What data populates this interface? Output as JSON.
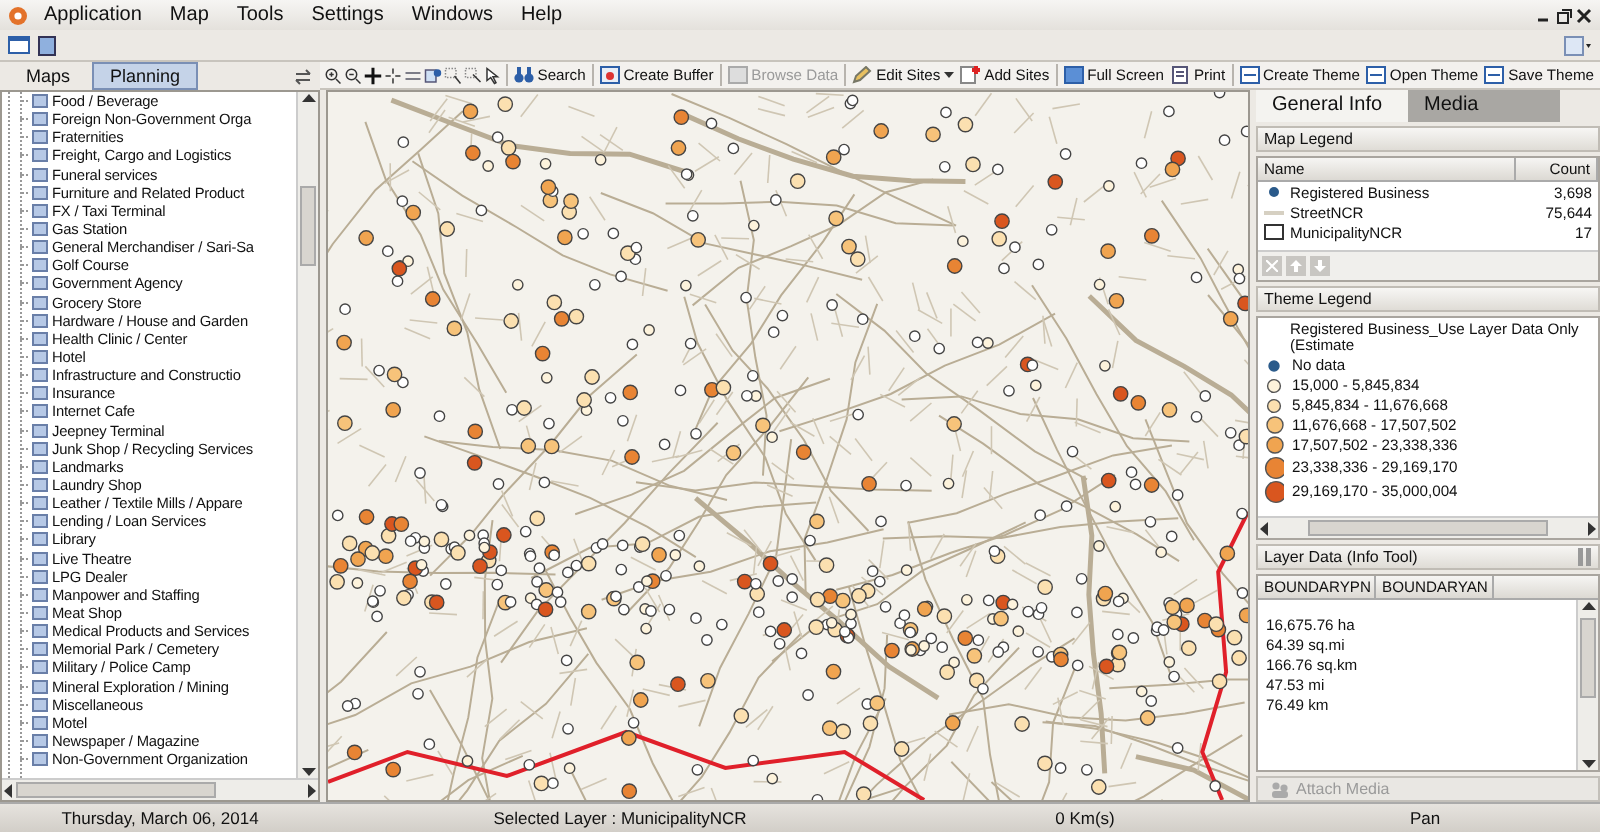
{
  "menu": [
    "Application",
    "Map",
    "Tools",
    "Settings",
    "Windows",
    "Help"
  ],
  "left_tabs": [
    {
      "label": "Maps",
      "selected": false
    },
    {
      "label": "Planning",
      "selected": true
    }
  ],
  "tree_items": [
    "Food / Beverage",
    "Foreign Non-Government Orga",
    "Fraternities",
    "Freight, Cargo and Logistics",
    "Funeral services",
    "Furniture and Related Product",
    "FX / Taxi Terminal",
    "Gas Station",
    "General Merchandiser / Sari-Sa",
    "Golf Course",
    "Government Agency",
    "Grocery Store",
    "Hardware / House and Garden",
    "Health Clinic / Center",
    "Hotel",
    "Infrastructure and Constructio",
    "Insurance",
    "Internet Cafe",
    "Jeepney Terminal",
    "Junk Shop / Recycling Services",
    "Landmarks",
    "Laundry Shop",
    "Leather / Textile Mills / Appare",
    "Lending / Loan Services",
    "Library",
    "Live Theatre",
    "LPG Dealer",
    "Manpower and Staffing",
    "Meat Shop",
    "Medical Products and Services",
    "Memorial Park / Cemetery",
    "Military / Police Camp",
    "Mineral Exploration / Mining",
    "Miscellaneous",
    "Motel",
    "Newspaper / Magazine",
    "Non-Government Organization"
  ],
  "map_toolbar": [
    {
      "kind": "search",
      "label": "Search",
      "disabled": false
    },
    {
      "kind": "buffer",
      "label": "Create Buffer",
      "disabled": false
    },
    {
      "kind": "browse",
      "label": "Browse Data",
      "disabled": true
    },
    {
      "kind": "edit",
      "label": "Edit Sites",
      "disabled": false
    },
    {
      "kind": "add",
      "label": "Add Sites",
      "disabled": false
    },
    {
      "kind": "screen",
      "label": "Full Screen",
      "disabled": false
    },
    {
      "kind": "print",
      "label": "Print",
      "disabled": false
    },
    {
      "kind": "theme",
      "label": "Create Theme",
      "disabled": false
    },
    {
      "kind": "theme",
      "label": "Open Theme",
      "disabled": false
    },
    {
      "kind": "theme",
      "label": "Save Theme",
      "disabled": false
    }
  ],
  "right_tabs": [
    {
      "label": "General Info",
      "selected": true
    },
    {
      "label": "Media",
      "selected": false
    }
  ],
  "map_legend": {
    "title": "Map Legend",
    "columns": [
      "Name",
      "Count"
    ],
    "rows": [
      {
        "kind": "dot",
        "name": "Registered Business",
        "count": "3,698"
      },
      {
        "kind": "line",
        "name": "StreetNCR",
        "count": "75,644"
      },
      {
        "kind": "box",
        "name": "MunicipalityNCR",
        "count": "17"
      }
    ]
  },
  "theme_legend": {
    "title": "Theme Legend",
    "layer": "Registered Business_Use Layer Data Only (Estimate",
    "items": [
      {
        "kind": "dot",
        "label": "No data",
        "color": "#2a5a8a"
      },
      {
        "kind": "small",
        "label": "15,000 - 5,845,834",
        "color": "#fdf3dc"
      },
      {
        "kind": "small",
        "label": "5,845,834 - 11,676,668",
        "color": "#fbe0b0"
      },
      {
        "kind": "medium",
        "label": "11,676,668 - 17,507,502",
        "color": "#f7c37a"
      },
      {
        "kind": "medium",
        "label": "17,507,502 - 23,338,336",
        "color": "#f0a450"
      },
      {
        "kind": "large",
        "label": "23,338,336 - 29,169,170",
        "color": "#e88434"
      },
      {
        "kind": "large",
        "label": "29,169,170 - 35,000,004",
        "color": "#d9561f"
      }
    ]
  },
  "layer_data": {
    "title": "Layer Data (Info Tool)",
    "columns": [
      "BOUNDARYPN",
      "BOUNDARYAN"
    ],
    "values": [
      "16,675.76 ha",
      "64.39 sq.mi",
      "166.76 sq.km",
      "47.53 mi",
      "76.49 km"
    ],
    "attach_button": {
      "label": "Attach Media",
      "disabled": true
    }
  },
  "status_bar": [
    "Thursday, March 06, 2014",
    "Selected Layer : MunicipalityNCR",
    "0 Km(s)",
    "Pan"
  ]
}
